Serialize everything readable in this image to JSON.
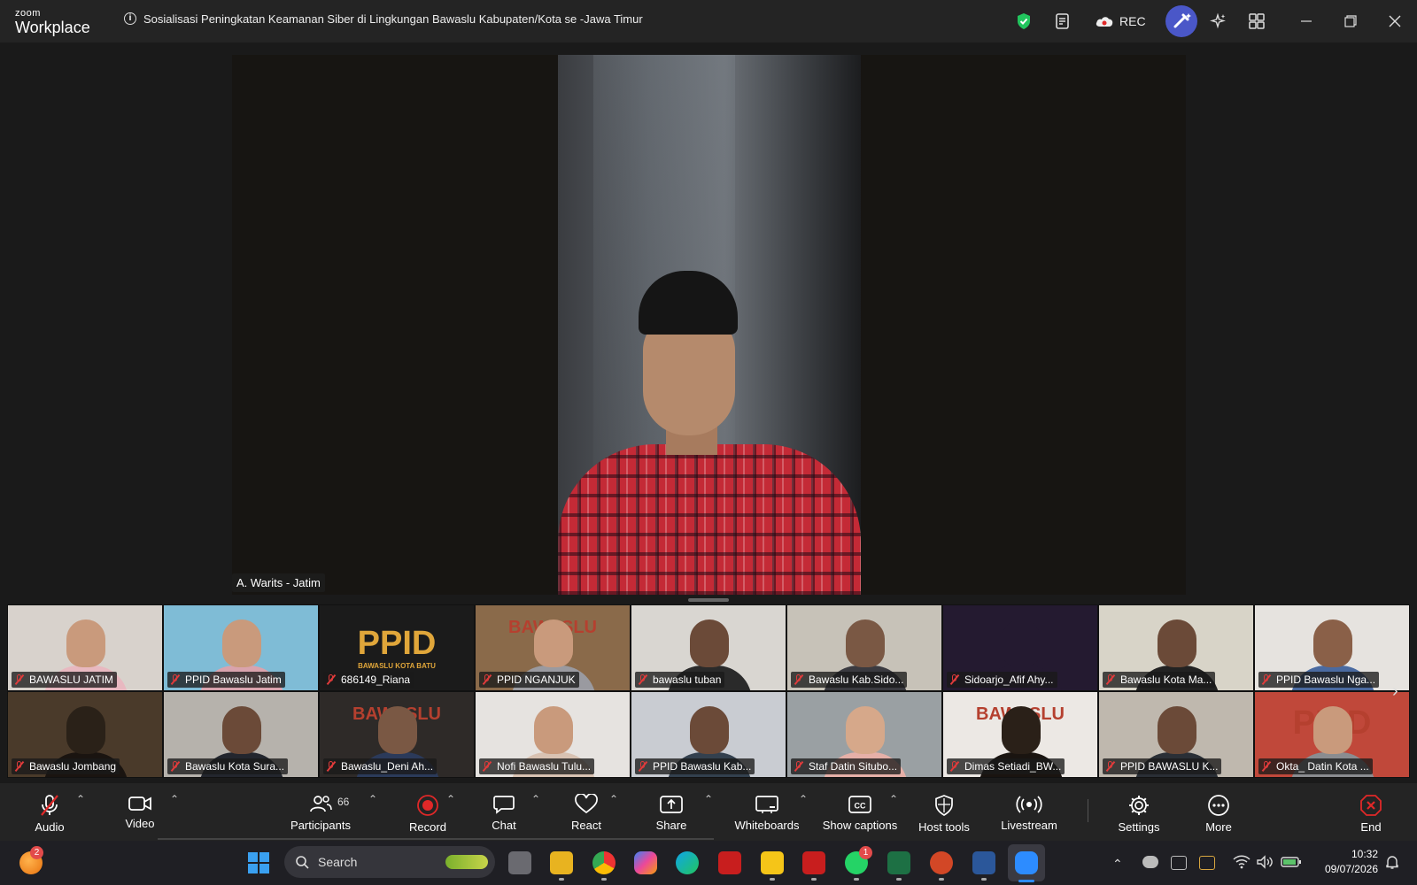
{
  "app": {
    "logo_small": "zoom",
    "logo_big": "Workplace"
  },
  "meeting": {
    "title": "Sosialisasi Peningkatan Keamanan Siber di Lingkungan Bawaslu Kabupaten/Kota se -Jawa Timur",
    "info_icon": "i"
  },
  "titlebar": {
    "rec_label": "REC",
    "icons": [
      "shield-check-icon",
      "notes-icon",
      "cloud-record-icon",
      "ai-companion-icon",
      "sparkle-icon",
      "apps-icon",
      "minimize-icon",
      "restore-icon",
      "close-icon"
    ]
  },
  "speaker": {
    "name": "A. Warits - Jatim"
  },
  "gallery": {
    "tiles": [
      {
        "name": "BAWASLU JATIM",
        "bg": "#d8d2cc",
        "skin": "#c99a7c",
        "cloth": "#e8b8c0"
      },
      {
        "name": "PPID Bawaslu Jatim",
        "bg": "#7fbcd6",
        "skin": "#c99a7c",
        "cloth": "#d9a3ad"
      },
      {
        "name": "686149_Riana",
        "bg": "#1b1b1b",
        "logo": "PPID",
        "logo_sub": "BAWASLU KOTA BATU"
      },
      {
        "name": "PPID NGANJUK",
        "bg": "#8a6a4a",
        "skin": "#c99a7c",
        "cloth": "#9a9aa0",
        "logo": "BAWASLU"
      },
      {
        "name": "bawaslu tuban",
        "bg": "#d9d6d1",
        "skin": "#6b4a38",
        "cloth": "#2a2a2a"
      },
      {
        "name": "Bawaslu Kab.Sido...",
        "bg": "#c7c2b8",
        "skin": "#7a5844",
        "cloth": "#3a3a40"
      },
      {
        "name": "Sidoarjo_Afif Ahy...",
        "bg": "#241a30",
        "skin": "#241a30",
        "cloth": "#241a30"
      },
      {
        "name": "Bawaslu Kota Ma...",
        "bg": "#d8d4c8",
        "skin": "#6b4a38",
        "cloth": "#222"
      },
      {
        "name": "PPID Bawaslu Nga...",
        "bg": "#e6e3df",
        "skin": "#8a6048",
        "cloth": "#4a6aa0"
      },
      {
        "name": "Bawaslu Jombang",
        "bg": "#4a3a2a",
        "skin": "#2a2118",
        "cloth": "#1a1410"
      },
      {
        "name": "Bawaslu Kota Sura...",
        "bg": "#b6b2ac",
        "skin": "#6b4a38",
        "cloth": "#23262e"
      },
      {
        "name": "Bawaslu_Deni Ah...",
        "bg": "#2e2a28",
        "skin": "#7a5844",
        "cloth": "#2b3a5a",
        "logo": "BAWASLU"
      },
      {
        "name": "Nofi Bawaslu Tulu...",
        "bg": "#e6e3e0",
        "skin": "#c99a7c",
        "cloth": "#d8c2b2"
      },
      {
        "name": "PPID Bawaslu Kab...",
        "bg": "#c9ccd2",
        "skin": "#6b4a38",
        "cloth": "#33404e"
      },
      {
        "name": "Staf Datin Situbo...",
        "bg": "#9aa0a3",
        "skin": "#d6a88a",
        "cloth": "#e6b0a8"
      },
      {
        "name": "Dimas Setiadi_BW...",
        "bg": "#ece8e4",
        "logo": "BAWASLU",
        "skin": "#2a2018",
        "cloth": "#1a1410"
      },
      {
        "name": "PPID BAWASLU K...",
        "bg": "#bfb8ae",
        "skin": "#6b4a38",
        "cloth": "#2a2f36"
      },
      {
        "name": "Okta_ Datin Kota ...",
        "bg": "#c0483a",
        "skin": "#c99a7c",
        "cloth": "#8a8c90",
        "logo": "PPID"
      }
    ],
    "next_icon": "chevron-right-icon"
  },
  "toolbar": {
    "audio": "Audio",
    "video": "Video",
    "participants": "Participants",
    "participants_count": "66",
    "record": "Record",
    "chat": "Chat",
    "react": "React",
    "share": "Share",
    "whiteboards": "Whiteboards",
    "captions": "Show captions",
    "captions_icon_text": "CC",
    "host_tools": "Host tools",
    "livestream": "Livestream",
    "settings": "Settings",
    "more": "More",
    "end": "End"
  },
  "taskbar": {
    "search_placeholder": "Search",
    "notification_badge": "2",
    "whatsapp_badge": "1",
    "time": "10:32",
    "date": "09/07/2026",
    "apps": [
      "windows-start",
      "file-explorer",
      "files",
      "chrome",
      "copilot",
      "edge",
      "mcafee",
      "sticky-notes",
      "mcafee-2",
      "whatsapp",
      "excel",
      "powerpoint",
      "word",
      "zoom"
    ]
  },
  "colors": {
    "accent": "#2d8cff",
    "record_red": "#e02828",
    "end_red": "#e02828",
    "shield_green": "#22c55e"
  }
}
